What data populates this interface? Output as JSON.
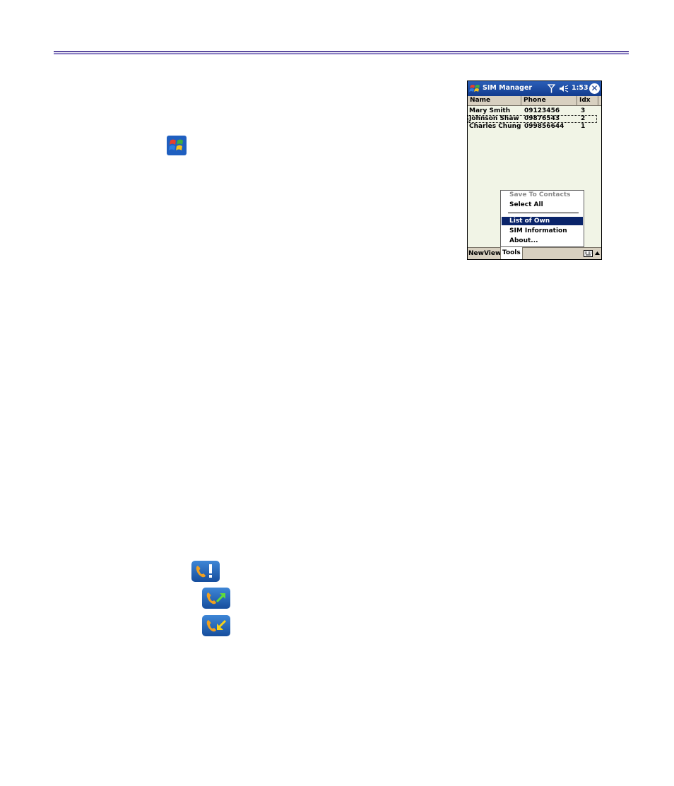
{
  "window": {
    "title": "SIM Manager",
    "time": "1:53",
    "close_glyph": "✕"
  },
  "columns": [
    "Name",
    "Phone",
    "Idx"
  ],
  "contacts": [
    {
      "name": "Mary Smith",
      "phone": "09123456",
      "idx": "3"
    },
    {
      "name": "Johnson Shaw",
      "phone": "09876543",
      "idx": "2"
    },
    {
      "name": "Charles Chung",
      "phone": "099856644",
      "idx": "1"
    }
  ],
  "tools_menu": {
    "items": [
      "Save To Contacts",
      "Select All",
      "List of Own Numbers",
      "SIM Information",
      "About..."
    ],
    "disabled_item": "Save To Contacts",
    "selected_item": "List of Own Numbers"
  },
  "menubar": {
    "items": [
      "New",
      "View",
      "Tools"
    ],
    "active_item": "Tools"
  },
  "icons": {
    "start": "windows-start-flag-icon",
    "missed_call": "phone-missed-call-icon",
    "outgoing_call": "phone-outgoing-call-icon",
    "incoming_call": "phone-incoming-call-icon"
  },
  "colors": {
    "header_rule": "#5a4a9e",
    "titlebar": "#123b8e",
    "menu_selected": "#0a246a",
    "list_background": "#f1f4e6"
  }
}
